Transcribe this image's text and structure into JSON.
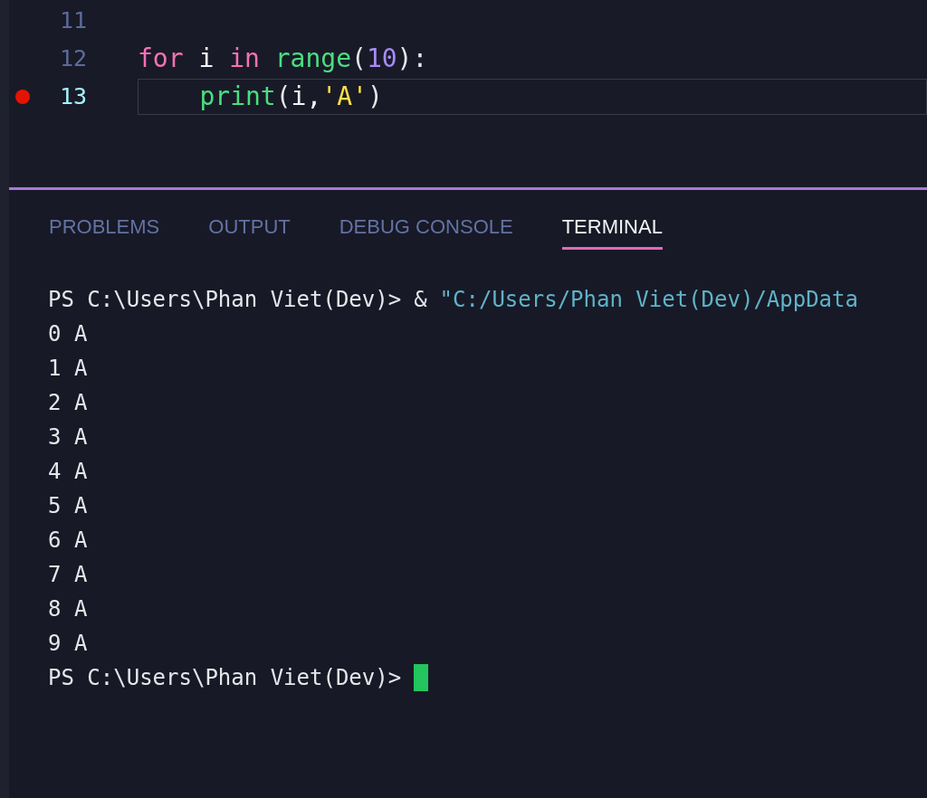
{
  "editor": {
    "lines": [
      {
        "number": "11",
        "breakpoint": false,
        "current": false
      },
      {
        "number": "12",
        "breakpoint": false,
        "current": false,
        "tokens": [
          {
            "kind": "keyword",
            "text": "for"
          },
          {
            "kind": "plain",
            "text": " i "
          },
          {
            "kind": "keyword",
            "text": "in "
          },
          {
            "kind": "function",
            "text": "range"
          },
          {
            "kind": "punct",
            "text": "("
          },
          {
            "kind": "number",
            "text": "10"
          },
          {
            "kind": "punct",
            "text": "):"
          }
        ]
      },
      {
        "number": "13",
        "breakpoint": true,
        "current": true,
        "tokens": [
          {
            "kind": "function",
            "text": "    print"
          },
          {
            "kind": "punct",
            "text": "("
          },
          {
            "kind": "plain",
            "text": "i,"
          },
          {
            "kind": "string",
            "text": "'A'"
          },
          {
            "kind": "punct",
            "text": ")"
          }
        ]
      }
    ]
  },
  "panel": {
    "tabs": [
      {
        "label": "PROBLEMS",
        "selected": false
      },
      {
        "label": "OUTPUT",
        "selected": false
      },
      {
        "label": "DEBUG CONSOLE",
        "selected": false
      },
      {
        "label": "TERMINAL",
        "selected": true
      }
    ],
    "terminal": {
      "lines": [
        {
          "kind": "command",
          "prompt": "PS C:\\Users\\Phan Viet(Dev)>",
          "operator": "&",
          "argument": "\"C:/Users/Phan Viet(Dev)/AppData"
        },
        {
          "kind": "output",
          "text": "0 A"
        },
        {
          "kind": "output",
          "text": "1 A"
        },
        {
          "kind": "output",
          "text": "2 A"
        },
        {
          "kind": "output",
          "text": "3 A"
        },
        {
          "kind": "output",
          "text": "4 A"
        },
        {
          "kind": "output",
          "text": "5 A"
        },
        {
          "kind": "output",
          "text": "6 A"
        },
        {
          "kind": "output",
          "text": "7 A"
        },
        {
          "kind": "output",
          "text": "8 A"
        },
        {
          "kind": "output",
          "text": "9 A"
        },
        {
          "kind": "prompt",
          "prompt": "PS C:\\Users\\Phan Viet(Dev)>",
          "cursor": true
        }
      ]
    }
  }
}
